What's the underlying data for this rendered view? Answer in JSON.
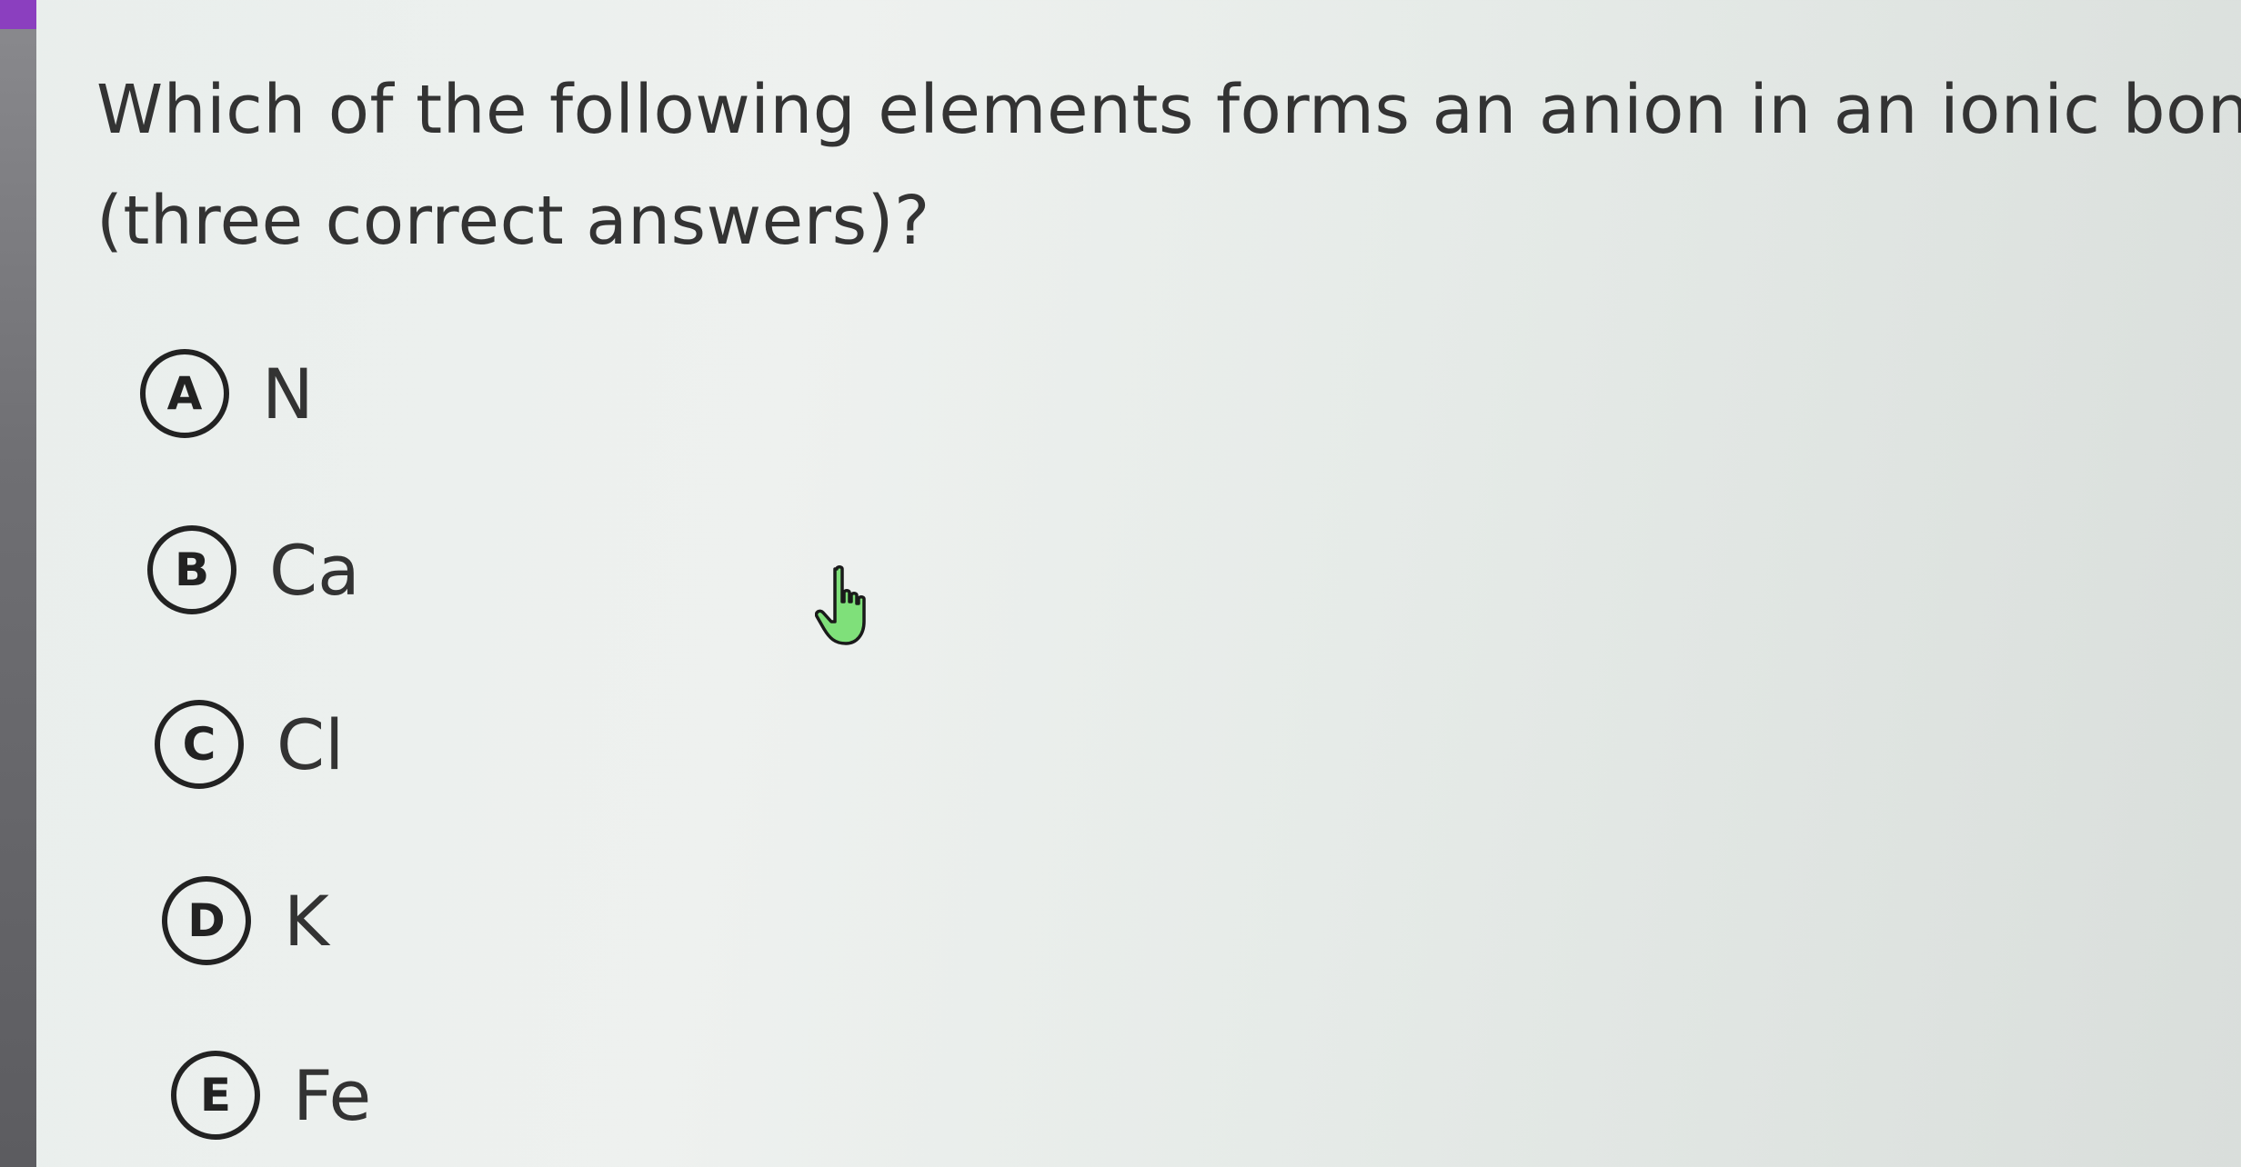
{
  "question": {
    "line1": "Which of the following elements forms an anion in an ionic bond",
    "line2": "(three correct answers)?"
  },
  "options": [
    {
      "letter": "A",
      "text": "N"
    },
    {
      "letter": "B",
      "text": "Ca"
    },
    {
      "letter": "C",
      "text": "Cl"
    },
    {
      "letter": "D",
      "text": "K"
    },
    {
      "letter": "E",
      "text": "Fe"
    }
  ],
  "colors": {
    "accent": "#8b3fbf",
    "cursor_fill": "#7fe07a",
    "cursor_outline": "#1a1a1a"
  },
  "icons": {
    "cursor": "hand-pointer-icon"
  }
}
